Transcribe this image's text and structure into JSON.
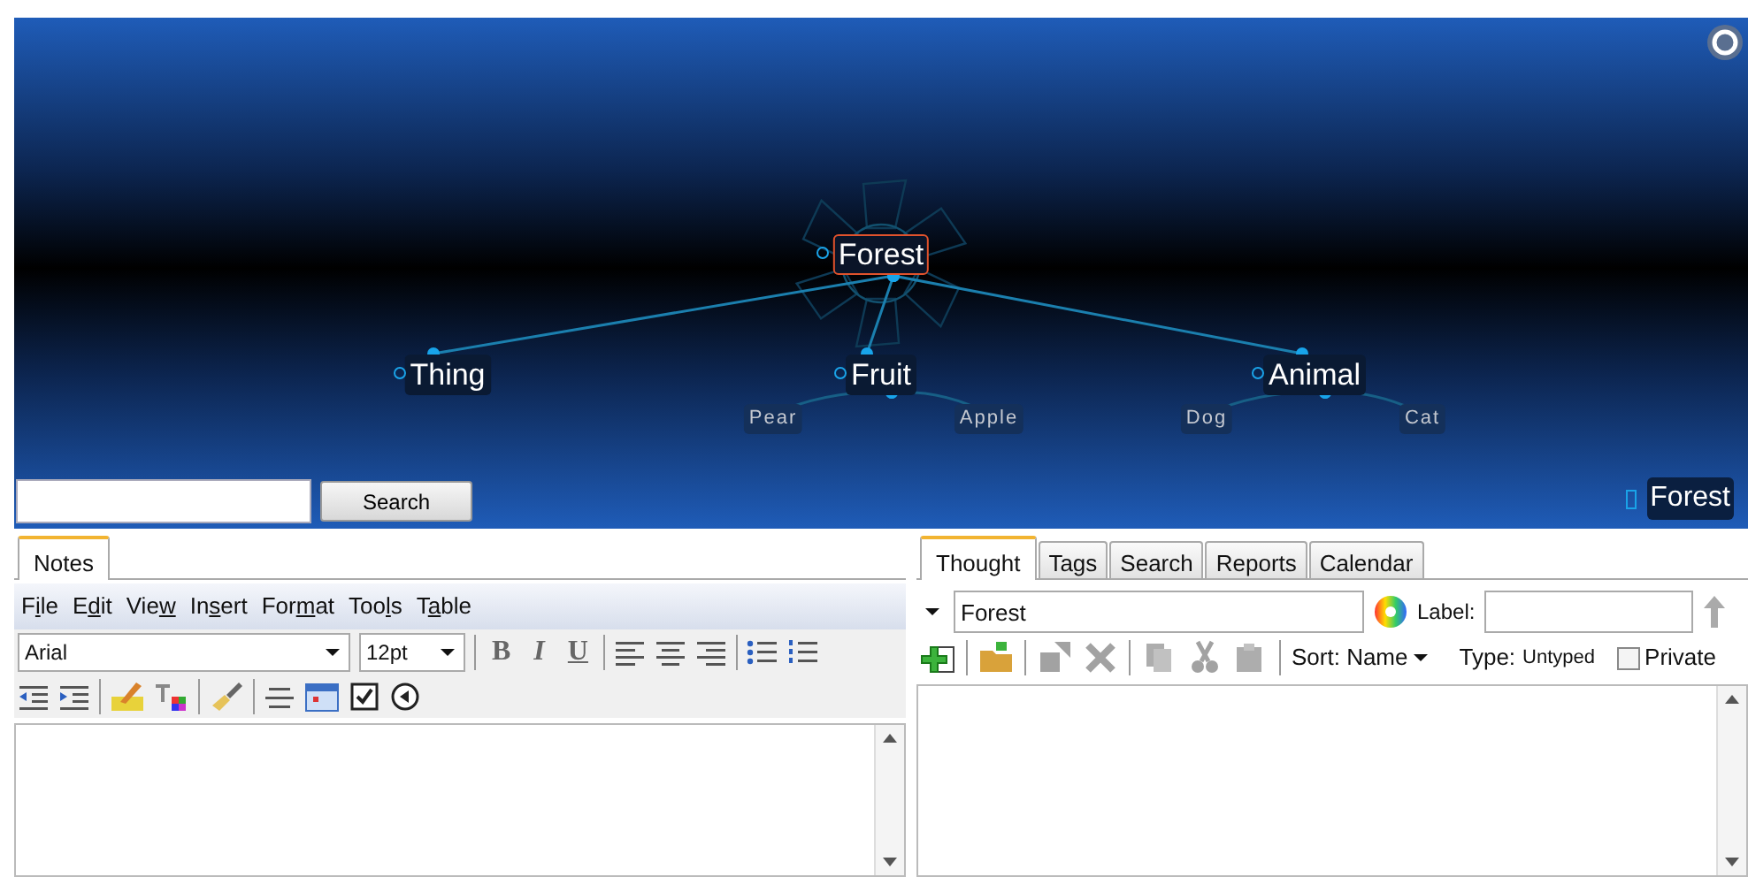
{
  "map": {
    "center": {
      "label": "Forest",
      "selected": true,
      "children": [
        {
          "label": "Thing",
          "selected": false
        },
        {
          "label": "Fruit",
          "selected": false,
          "children": [
            {
              "label": "Pear",
              "selected": false
            },
            {
              "label": "Apple",
              "selected": false
            }
          ]
        },
        {
          "label": "Animal",
          "selected": false,
          "children": [
            {
              "label": "Dog",
              "selected": false
            },
            {
              "label": "Cat",
              "selected": false
            }
          ]
        }
      ]
    }
  },
  "search": {
    "button": "Search"
  },
  "breadcrumb": "Forest",
  "notes": {
    "tabs": [
      {
        "label": "Notes",
        "selected": true
      }
    ],
    "menu": [
      {
        "start": "F",
        "mnemonic": "i",
        "end": "le"
      },
      {
        "start": "E",
        "mnemonic": "d",
        "end": "it"
      },
      {
        "start": "Vie",
        "mnemonic": "w"
      },
      {
        "start": "In",
        "mnemonic": "s",
        "end": "ert"
      },
      {
        "start": "For",
        "mnemonic": "m",
        "end": "at"
      },
      {
        "start": "Too",
        "mnemonic": "l",
        "end": "s"
      },
      {
        "start": "T",
        "mnemonic": "a",
        "end": "ble"
      }
    ],
    "font": "Arial",
    "size": "12pt",
    "format_buttons": [
      "B",
      "I",
      "U"
    ]
  },
  "thought": {
    "tabs": [
      {
        "label": "Thought",
        "selected": true
      },
      {
        "label": "Tags",
        "selected": false
      },
      {
        "label": "Search",
        "selected": false
      },
      {
        "label": "Reports",
        "selected": false
      },
      {
        "label": "Calendar",
        "selected": false
      }
    ],
    "name": "Forest",
    "label_caption": "Label:",
    "toolbar": [
      {
        "disabled": false
      },
      {
        "disabled": false
      },
      {
        "disabled": true
      },
      {
        "disabled": true
      },
      {
        "disabled": true
      },
      {
        "disabled": true
      },
      {
        "disabled": true
      }
    ],
    "sort": "Sort: Name",
    "type_caption": "Type:",
    "type_value": "Untyped",
    "private": {
      "label": "Private",
      "checked": false
    }
  }
}
